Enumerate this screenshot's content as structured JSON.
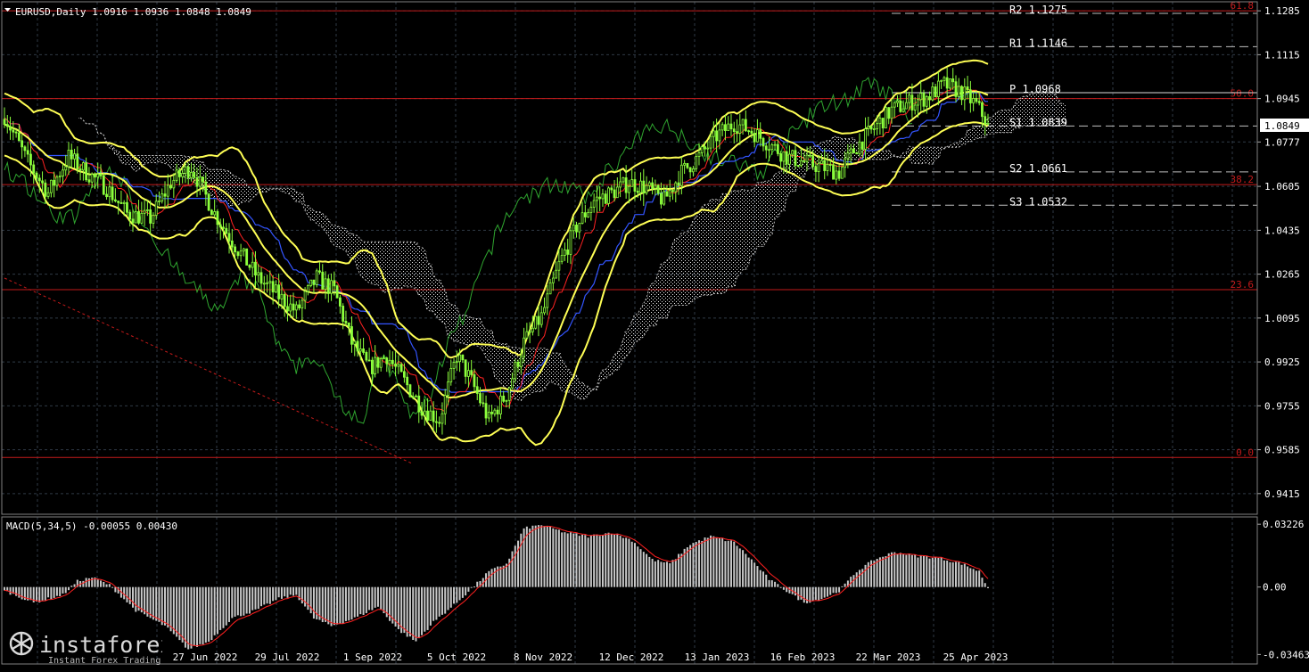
{
  "header": {
    "symbol_info": "EURUSD,Daily",
    "ohlc": "1.0916 1.0936 1.0848 1.0849"
  },
  "colors": {
    "background": "#000000",
    "grid": "#2f3a46",
    "candles": "#8cff3c",
    "bollinger": "#ffff55",
    "kijun": "#3355ff",
    "tenkan": "#ff2222",
    "chikou": "#2fa52f",
    "kumo": "#e8e8e8",
    "fib": "#c21a1a",
    "pivot": "#e0e0e0",
    "macd_hist": "#c8c8c8",
    "macd_signal": "#ff2020"
  },
  "chart_data": [
    {
      "type": "line",
      "title": "EURUSD,Daily",
      "y_ticks": [
        "1.1285",
        "1.1115",
        "1.0945",
        "1.0777",
        "1.0605",
        "1.0435",
        "1.0265",
        "1.0095",
        "0.9925",
        "0.9755",
        "0.9585",
        "0.9415"
      ],
      "ylim": [
        0.9335,
        1.132
      ],
      "x_ticks": [
        "27 Jun 2022",
        "29 Jul 2022",
        "1 Sep 2022",
        "5 Oct 2022",
        "8 Nov 2022",
        "12 Dec 2022",
        "13 Jan 2023",
        "16 Feb 2023",
        "22 Mar 2023",
        "25 Apr 2023"
      ],
      "current_price_label": "1.0849",
      "current_price": 1.0849,
      "grid": true,
      "fibonacci_levels": [
        {
          "label": "61.8",
          "value": 1.1285
        },
        {
          "label": "50.0",
          "value": 1.0945
        },
        {
          "label": "38.2",
          "value": 1.0612
        },
        {
          "label": "23.6",
          "value": 1.0205
        },
        {
          "label": "0.0",
          "value": 0.9555
        }
      ],
      "pivot_levels": [
        {
          "label": "R2",
          "value_text": "1.1275",
          "value": 1.1275
        },
        {
          "label": "R1",
          "value_text": "1.1146",
          "value": 1.1146
        },
        {
          "label": "P",
          "value_text": "1.0968",
          "value": 1.0968
        },
        {
          "label": "S1",
          "value_text": "1.0839",
          "value": 1.0839
        },
        {
          "label": "S2",
          "value_text": "1.0661",
          "value": 1.0661
        },
        {
          "label": "S3",
          "value_text": "1.0532",
          "value": 1.0532
        }
      ],
      "price_anchors": [
        [
          0,
          1.088
        ],
        [
          8,
          1.07
        ],
        [
          15,
          1.058
        ],
        [
          22,
          1.072
        ],
        [
          28,
          1.066
        ],
        [
          35,
          1.06
        ],
        [
          42,
          1.05
        ],
        [
          50,
          1.048
        ],
        [
          57,
          1.062
        ],
        [
          64,
          1.068
        ],
        [
          72,
          1.05
        ],
        [
          80,
          1.036
        ],
        [
          87,
          1.025
        ],
        [
          94,
          1.018
        ],
        [
          100,
          1.012
        ],
        [
          107,
          1.025
        ],
        [
          113,
          1.02
        ],
        [
          119,
          1.0
        ],
        [
          125,
          0.99
        ],
        [
          131,
          0.995
        ],
        [
          137,
          0.985
        ],
        [
          143,
          0.975
        ],
        [
          149,
          0.97
        ],
        [
          155,
          0.995
        ],
        [
          160,
          0.985
        ],
        [
          166,
          0.97
        ],
        [
          172,
          0.98
        ],
        [
          178,
          1.0
        ],
        [
          184,
          1.01
        ],
        [
          190,
          1.03
        ],
        [
          196,
          1.045
        ],
        [
          202,
          1.055
        ],
        [
          208,
          1.058
        ],
        [
          214,
          1.062
        ],
        [
          220,
          1.06
        ],
        [
          226,
          1.055
        ],
        [
          232,
          1.066
        ],
        [
          238,
          1.072
        ],
        [
          244,
          1.08
        ],
        [
          250,
          1.085
        ],
        [
          256,
          1.082
        ],
        [
          262,
          1.077
        ],
        [
          268,
          1.072
        ],
        [
          274,
          1.07
        ],
        [
          280,
          1.068
        ],
        [
          286,
          1.066
        ],
        [
          292,
          1.076
        ],
        [
          298,
          1.083
        ],
        [
          304,
          1.09
        ],
        [
          310,
          1.093
        ],
        [
          316,
          1.095
        ],
        [
          322,
          1.1
        ],
        [
          328,
          1.097
        ],
        [
          333,
          1.092
        ],
        [
          337,
          1.0849
        ]
      ],
      "macd": {
        "label": "MACD(5,34,5) -0.00055 0.00430",
        "y_ticks": [
          "0.03226",
          "0.00",
          "-0.03463"
        ],
        "ylim": [
          -0.0395,
          0.036
        ],
        "hist_anchors": [
          [
            0,
            -0.002
          ],
          [
            10,
            -0.008
          ],
          [
            20,
            -0.004
          ],
          [
            25,
            0.003
          ],
          [
            30,
            0.005
          ],
          [
            36,
            0.001
          ],
          [
            45,
            -0.012
          ],
          [
            55,
            -0.02
          ],
          [
            63,
            -0.032
          ],
          [
            70,
            -0.028
          ],
          [
            78,
            -0.016
          ],
          [
            86,
            -0.012
          ],
          [
            94,
            -0.006
          ],
          [
            100,
            -0.004
          ],
          [
            106,
            -0.016
          ],
          [
            112,
            -0.02
          ],
          [
            120,
            -0.016
          ],
          [
            128,
            -0.01
          ],
          [
            135,
            -0.022
          ],
          [
            141,
            -0.028
          ],
          [
            147,
            -0.018
          ],
          [
            155,
            -0.008
          ],
          [
            162,
            0.002
          ],
          [
            166,
            0.008
          ],
          [
            172,
            0.012
          ],
          [
            178,
            0.03
          ],
          [
            184,
            0.032
          ],
          [
            192,
            0.028
          ],
          [
            200,
            0.026
          ],
          [
            208,
            0.028
          ],
          [
            215,
            0.024
          ],
          [
            222,
            0.014
          ],
          [
            228,
            0.012
          ],
          [
            235,
            0.022
          ],
          [
            242,
            0.026
          ],
          [
            250,
            0.023
          ],
          [
            256,
            0.014
          ],
          [
            262,
            0.004
          ],
          [
            268,
            -0.002
          ],
          [
            274,
            -0.008
          ],
          [
            280,
            -0.006
          ],
          [
            286,
            -0.002
          ],
          [
            292,
            0.008
          ],
          [
            298,
            0.014
          ],
          [
            305,
            0.018
          ],
          [
            312,
            0.016
          ],
          [
            320,
            0.015
          ],
          [
            328,
            0.012
          ],
          [
            334,
            0.008
          ],
          [
            337,
            -0.0006
          ]
        ],
        "signal_last": 0.0043
      }
    }
  ],
  "watermark": {
    "brand": "instaforex",
    "tagline": "Instant Forex Trading"
  }
}
